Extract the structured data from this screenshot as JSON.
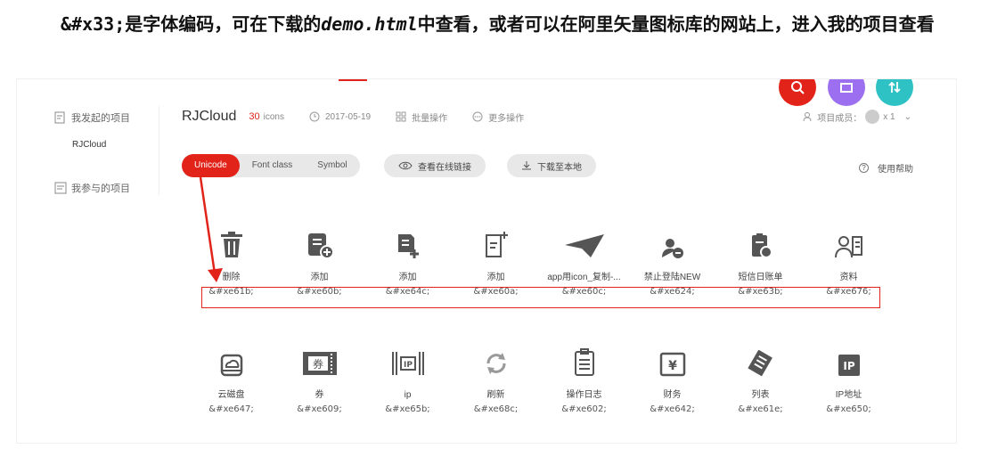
{
  "article": {
    "code": "&#x33;",
    "text1": "是字体编码，可在下载的",
    "file": "demo.html",
    "text2": "中查看，或者可以在阿里矢量图标库的网站上，进入我的项目查看"
  },
  "sidebar": {
    "my_projects": "我发起的项目",
    "project": "RJCloud",
    "joined": "我参与的项目"
  },
  "header": {
    "project_name": "RJCloud",
    "icon_count": "30",
    "icons_label": "icons",
    "date": "2017-05-19",
    "batch": "批量操作",
    "more": "更多操作",
    "members": "项目成员：",
    "member_count": "x 1"
  },
  "tabs": [
    "Unicode",
    "Font class",
    "Symbol"
  ],
  "buttons": {
    "view_online": "查看在线链接",
    "download": "下载至本地",
    "help": "使用帮助"
  },
  "icons_row1": [
    {
      "label": "删除",
      "code": "&#xe61b;",
      "icon": "trash-icon"
    },
    {
      "label": "添加",
      "code": "&#xe60b;",
      "icon": "doc-add-icon"
    },
    {
      "label": "添加",
      "code": "&#xe64c;",
      "icon": "doc-plus-icon"
    },
    {
      "label": "添加",
      "code": "&#xe60a;",
      "icon": "page-plus-icon"
    },
    {
      "label": "app用icon_复制-...",
      "code": "&#xe60c;",
      "icon": "paper-plane-icon"
    },
    {
      "label": "禁止登陆NEW",
      "code": "&#xe624;",
      "icon": "user-forbid-icon"
    },
    {
      "label": "短信日账单",
      "code": "&#xe63b;",
      "icon": "sms-bill-icon"
    },
    {
      "label": "资料",
      "code": "&#xe676;",
      "icon": "profile-icon"
    }
  ],
  "icons_row2": [
    {
      "label": "云磁盘",
      "code": "&#xe647;",
      "icon": "cloud-disk-icon"
    },
    {
      "label": "券",
      "code": "&#xe609;",
      "icon": "coupon-icon"
    },
    {
      "label": "ip",
      "code": "&#xe65b;",
      "icon": "ip-frame-icon"
    },
    {
      "label": "刷新",
      "code": "&#xe68c;",
      "icon": "refresh-icon"
    },
    {
      "label": "操作日志",
      "code": "&#xe602;",
      "icon": "clipboard-icon"
    },
    {
      "label": "财务",
      "code": "&#xe642;",
      "icon": "finance-icon"
    },
    {
      "label": "列表",
      "code": "&#xe61e;",
      "icon": "list-icon"
    },
    {
      "label": "IP地址",
      "code": "&#xe650;",
      "icon": "ip-address-icon"
    }
  ],
  "colors": {
    "accent": "#e2231a",
    "purple": "#9c6ff0",
    "teal": "#2fc2c5"
  }
}
